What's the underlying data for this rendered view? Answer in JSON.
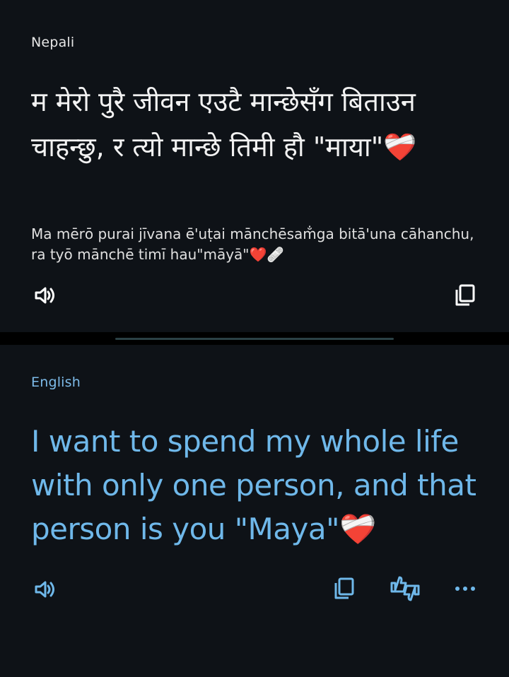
{
  "source": {
    "language": "Nepali",
    "text": "म मेरो पुरै जीवन एउटै मान्छेसँग बिताउन चाहन्छु, र त्यो मान्छे तिमी हौ \"माया\"❤️‍🩹",
    "transliteration": "Ma mērō purai jīvana ē'uṭai mānchēsam̐ga bitā'una cāhanchu, ra tyō mānchē timī hau\"māyā\"❤️🩹",
    "speak_icon": "speaker-icon",
    "copy_icon": "copy-icon"
  },
  "target": {
    "language": "English",
    "text": "I want to spend my whole life with only one person, and that person is you \"Maya\"❤️‍🩹",
    "speak_icon": "speaker-icon",
    "copy_icon": "copy-icon",
    "rate_icon": "thumbs-up-down-icon",
    "more_icon": "more-icon"
  },
  "colors": {
    "background": "#0e1217",
    "accent": "#6fb8ea",
    "divider": "#2b4146"
  }
}
